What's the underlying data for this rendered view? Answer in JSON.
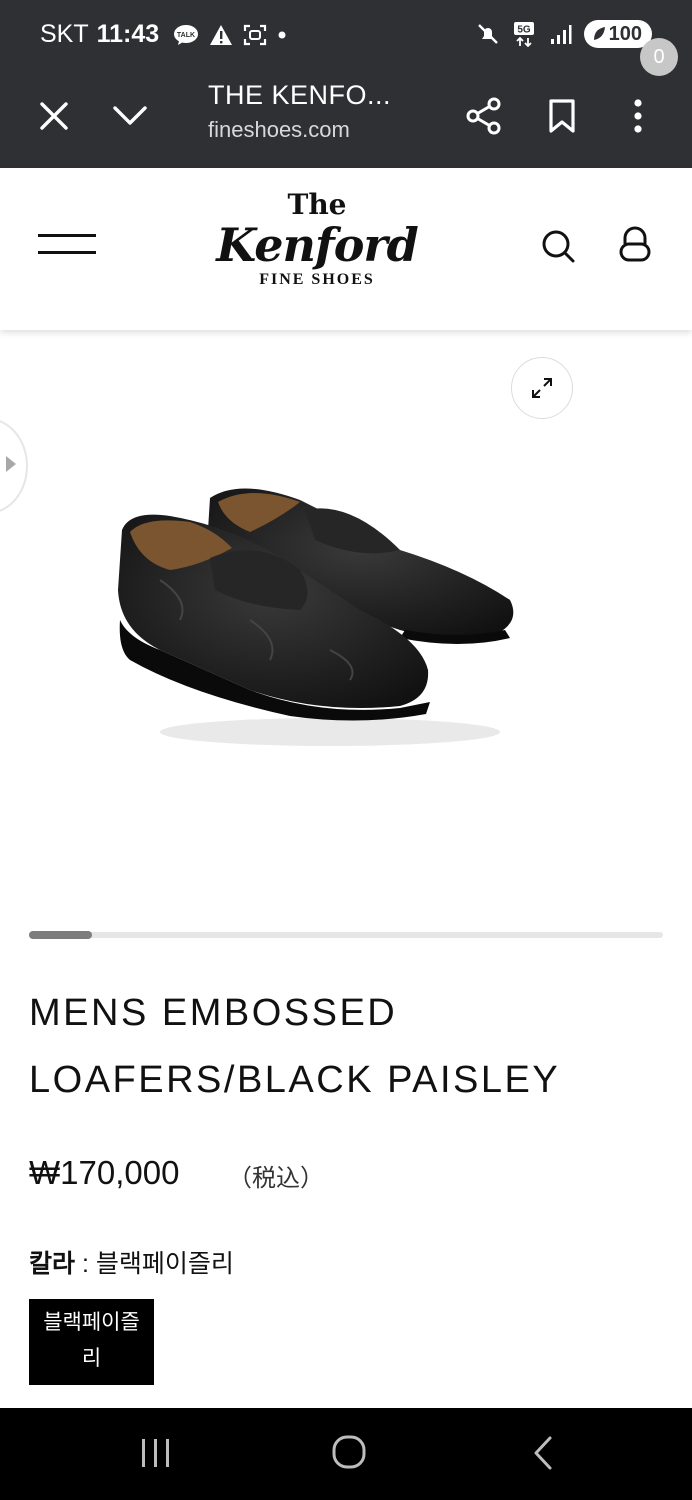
{
  "status_bar": {
    "carrier": "SKT",
    "time": "11:43",
    "talk_label": "TALK",
    "network": "5G",
    "battery": "100"
  },
  "browser": {
    "title": "THE KENFO...",
    "url": "fineshoes.com"
  },
  "site": {
    "logo_the": "The",
    "logo_name": "Kenford",
    "logo_sub": "FINE SHOES",
    "cart_count": "0"
  },
  "gallery": {
    "progress": 0.1
  },
  "product": {
    "title": "MENS EMBOSSED LOAFERS/BLACK PAISLEY",
    "price": "₩170,000",
    "tax_note": "（税込）",
    "color_label": "칼라",
    "color_separator": " : ",
    "color_value": "블랙페이즐리",
    "swatch_label": "블랙페이즐\n리"
  },
  "colors": {
    "system_bar": "#2f3033",
    "text": "#111111",
    "swatch": "#000000",
    "badge": "#c7c7c7"
  }
}
